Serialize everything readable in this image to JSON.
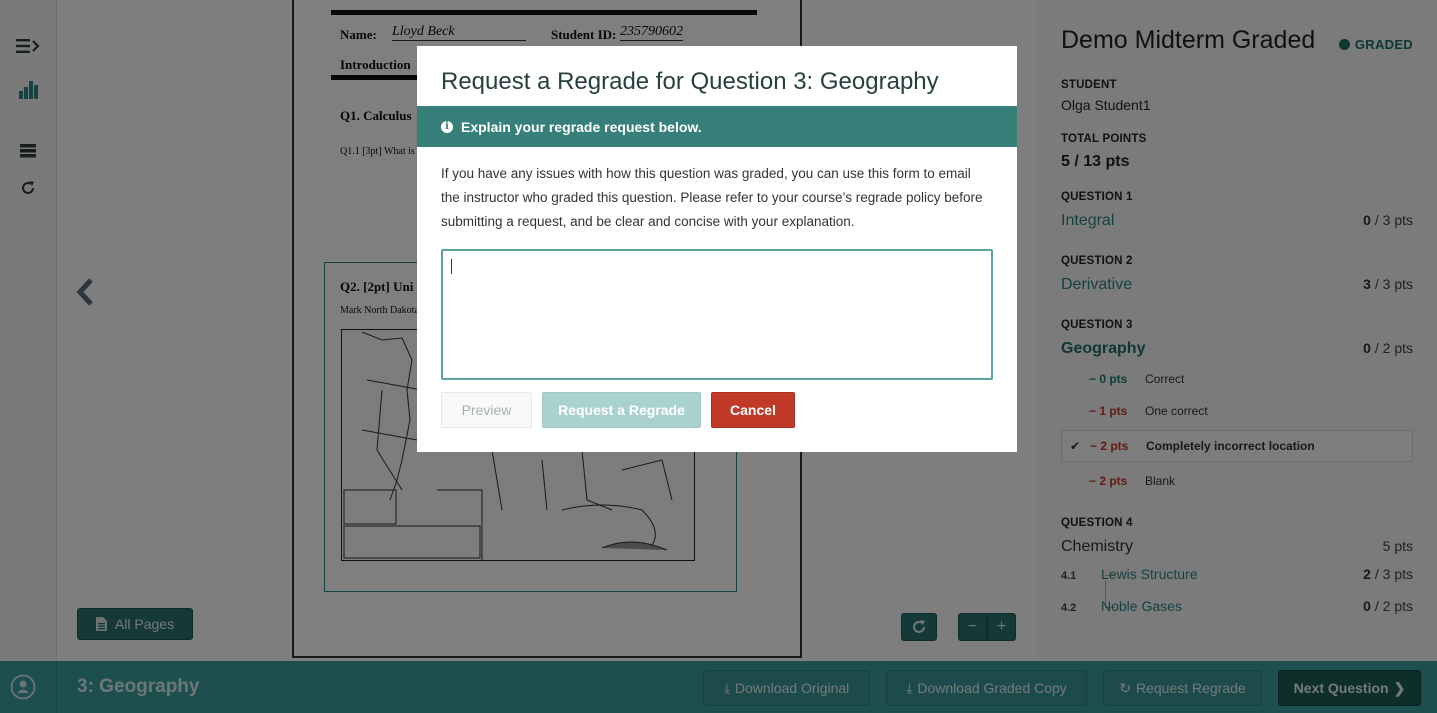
{
  "left_rail": {
    "icons": [
      "menu-expand-icon",
      "statistics-icon",
      "outline-icon",
      "refresh-icon"
    ]
  },
  "document": {
    "name_label": "Name:",
    "name_value": "Lloyd Beck",
    "student_id_label": "Student ID:",
    "student_id_value": "235790602",
    "section_heading": "Introduction",
    "q1_heading": "Q1.  Calculus",
    "q1_1_text": "Q1.1  [3pt] What is",
    "q2_heading": "Q2.  [2pt] Uni",
    "q2_text": "Mark North Dakota"
  },
  "viewer": {
    "all_pages_label": "All Pages",
    "zoom_out_label": "−",
    "zoom_in_label": "+"
  },
  "sidebar": {
    "title": "Demo Midterm Graded",
    "status": "GRADED",
    "student_label": "STUDENT",
    "student_name": "Olga Student1",
    "total_label": "TOTAL POINTS",
    "total_value": "5 / 13 pts",
    "questions": [
      {
        "label": "QUESTION 1",
        "name": "Integral",
        "earned": "0",
        "possible": " / 3 pts"
      },
      {
        "label": "QUESTION 2",
        "name": "Derivative",
        "earned": "3",
        "possible": " / 3 pts"
      },
      {
        "label": "QUESTION 3",
        "name": "Geography",
        "earned": "0",
        "possible": " / 2 pts",
        "rubric": [
          {
            "points": "− 0 pts",
            "description": "Correct",
            "selected": false
          },
          {
            "points": "− 1 pts",
            "description": "One correct",
            "selected": false
          },
          {
            "points": "− 2 pts",
            "description": "Completely incorrect location",
            "selected": true
          },
          {
            "points": "− 2 pts",
            "description": "Blank",
            "selected": false
          }
        ]
      },
      {
        "label": "QUESTION 4",
        "name": "Chemistry",
        "total": "5 pts",
        "subquestions": [
          {
            "number": "4.1",
            "name": "Lewis Structure",
            "earned": "2",
            "possible": " / 3 pts"
          },
          {
            "number": "4.2",
            "name": "Noble Gases",
            "earned": "0",
            "possible": " / 2 pts"
          }
        ]
      }
    ]
  },
  "bottom_bar": {
    "current_question": "3: Geography",
    "download_original": "Download Original",
    "download_graded": "Download Graded Copy",
    "request_regrade": "Request Regrade",
    "next_question": "Next Question"
  },
  "modal": {
    "title": "Request a Regrade for Question 3: Geography",
    "alert": "Explain your regrade request below.",
    "body": "If you have any issues with how this question was graded, you can use this form to email the instructor who graded this question. Please refer to your course’s regrade policy before submitting a request, and be clear and concise with your explanation.",
    "textarea_value": "",
    "preview_label": "Preview",
    "submit_label": "Request a Regrade",
    "cancel_label": "Cancel"
  },
  "colors": {
    "accent": "#378079",
    "bottom_bar": "#3a9e9e",
    "danger": "#c13a27",
    "graded": "#1e7060"
  }
}
